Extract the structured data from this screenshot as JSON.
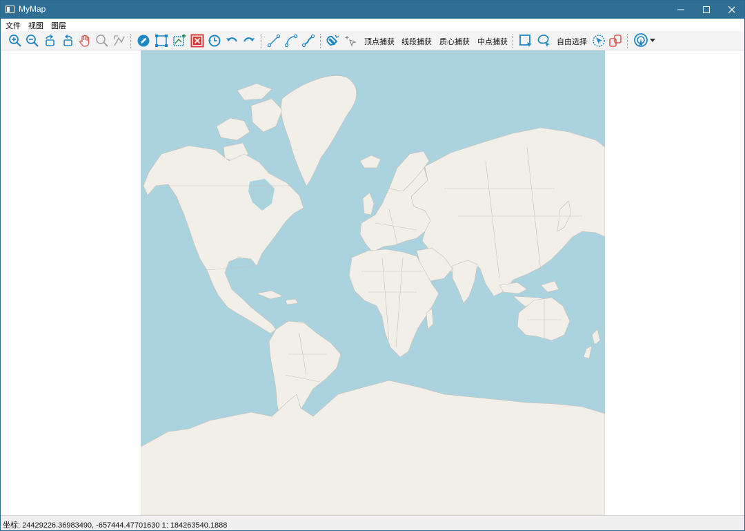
{
  "window": {
    "title": "MyMap"
  },
  "menubar": {
    "items": [
      "文件",
      "视图",
      "图层"
    ]
  },
  "toolbar": {
    "snap_vertex": "顶点捕获",
    "snap_segment": "线段捕获",
    "snap_centroid": "质心捕获",
    "snap_midpoint": "中点捕获",
    "free_select": "自由选择"
  },
  "map": {
    "ocean_color": "#aad3df",
    "land_color": "#f2efe9",
    "border_color": "#c9bfb6"
  },
  "colors": {
    "titlebar": "#2e6f93",
    "icon_blue": "#1e88c7",
    "icon_red": "#d73a3a"
  },
  "status": {
    "text": "坐标: 24429226.36983490, -657444.47701630 1:  184263540.1888"
  }
}
